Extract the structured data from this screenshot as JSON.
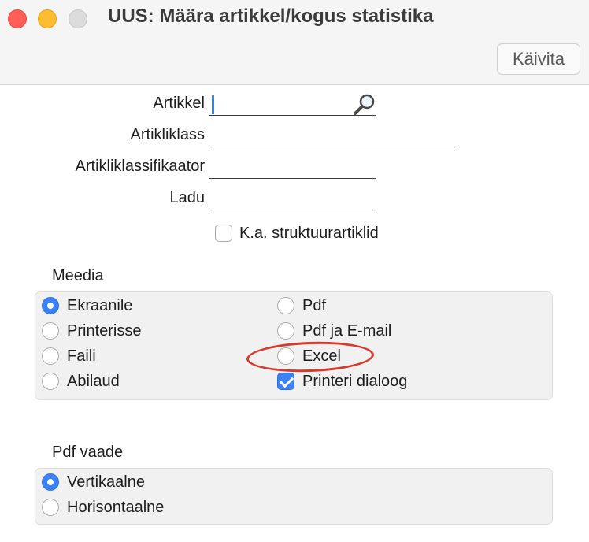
{
  "window": {
    "title": "UUS: Määra artikkel/kogus statistika",
    "run_button": "Käivita"
  },
  "form": {
    "artikkel_label": "Artikkel",
    "artikkel_value": "",
    "artikliklass_label": "Artikliklass",
    "artikliklass_value": "",
    "klassifikaator_label": "Artikliklassifikaator",
    "klassifikaator_value": "",
    "ladu_label": "Ladu",
    "ladu_value": "",
    "struktuur_label": "K.a. struktuurartiklid",
    "struktuur_checked": false
  },
  "media": {
    "heading": "Meedia",
    "options": [
      {
        "label": "Ekraanile",
        "selected": true
      },
      {
        "label": "Printerisse",
        "selected": false
      },
      {
        "label": "Faili",
        "selected": false
      },
      {
        "label": "Abilaud",
        "selected": false
      },
      {
        "label": "Pdf",
        "selected": false
      },
      {
        "label": "Pdf ja E-mail",
        "selected": false
      },
      {
        "label": "Excel",
        "selected": false
      }
    ],
    "printer_dialog_label": "Printeri dialoog",
    "printer_dialog_checked": true
  },
  "pdf_view": {
    "heading": "Pdf vaade",
    "options": [
      {
        "label": "Vertikaalne",
        "selected": true
      },
      {
        "label": "Horisontaalne",
        "selected": false
      }
    ]
  },
  "colors": {
    "accent": "#3b82f6",
    "highlight": "#d63a2a"
  }
}
